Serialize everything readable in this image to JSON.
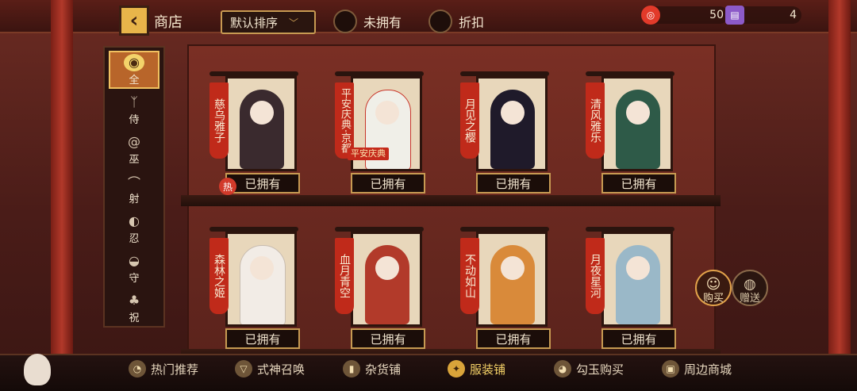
{
  "header": {
    "back_icon": "chevron-left-icon",
    "title": "商店",
    "sort_label": "默认排序",
    "filters": [
      {
        "label": "未拥有"
      },
      {
        "label": "折扣"
      }
    ],
    "currencies": [
      {
        "icon": "coin-icon",
        "value": "50",
        "color": "#e23a2a"
      },
      {
        "icon": "ticket-icon",
        "value": "4",
        "color": "#8c5ac8"
      }
    ]
  },
  "tabs": [
    {
      "label": "全",
      "icon": "crest-icon",
      "active": true
    },
    {
      "label": "侍",
      "icon": "fan-icon",
      "active": false
    },
    {
      "label": "巫",
      "icon": "spiral-icon",
      "active": false
    },
    {
      "label": "射",
      "icon": "bird-icon",
      "active": false
    },
    {
      "label": "忍",
      "icon": "mask-icon",
      "active": false
    },
    {
      "label": "守",
      "icon": "shield-icon",
      "active": false
    },
    {
      "label": "祝",
      "icon": "clover-icon",
      "active": false
    }
  ],
  "cards": [
    {
      "name": "慈乌雅子",
      "status": "已拥有",
      "hot": "热",
      "color": "#3a2a2e"
    },
    {
      "name": "平安庆典·京都",
      "status": "已拥有",
      "tag": "平安庆典",
      "color": "#f0efe8"
    },
    {
      "name": "月见之樱",
      "status": "已拥有",
      "color": "#1f1a2a"
    },
    {
      "name": "清风雅乐",
      "status": "已拥有",
      "color": "#2e5a48"
    },
    {
      "name": "森林之姬",
      "status": "已拥有",
      "color": "#f2ece6"
    },
    {
      "name": "血月青空",
      "status": "已拥有",
      "color": "#b23a2a"
    },
    {
      "name": "不动如山",
      "status": "已拥有",
      "color": "#d98a3a"
    },
    {
      "name": "月夜星河",
      "status": "已拥有",
      "color": "#9ab8c8"
    }
  ],
  "actions": {
    "buy": "购买",
    "gift": "赠送"
  },
  "bottom_nav": [
    {
      "label": "热门推荐",
      "icon": "tomoe-icon",
      "active": false
    },
    {
      "label": "式神召唤",
      "icon": "fox-mask-icon",
      "active": false
    },
    {
      "label": "杂货铺",
      "icon": "bottle-icon",
      "active": false
    },
    {
      "label": "服装铺",
      "icon": "kimono-icon",
      "active": true
    },
    {
      "label": "勾玉购买",
      "icon": "magatama-icon",
      "active": false
    },
    {
      "label": "周边商城",
      "icon": "gift-box-icon",
      "active": false
    }
  ]
}
